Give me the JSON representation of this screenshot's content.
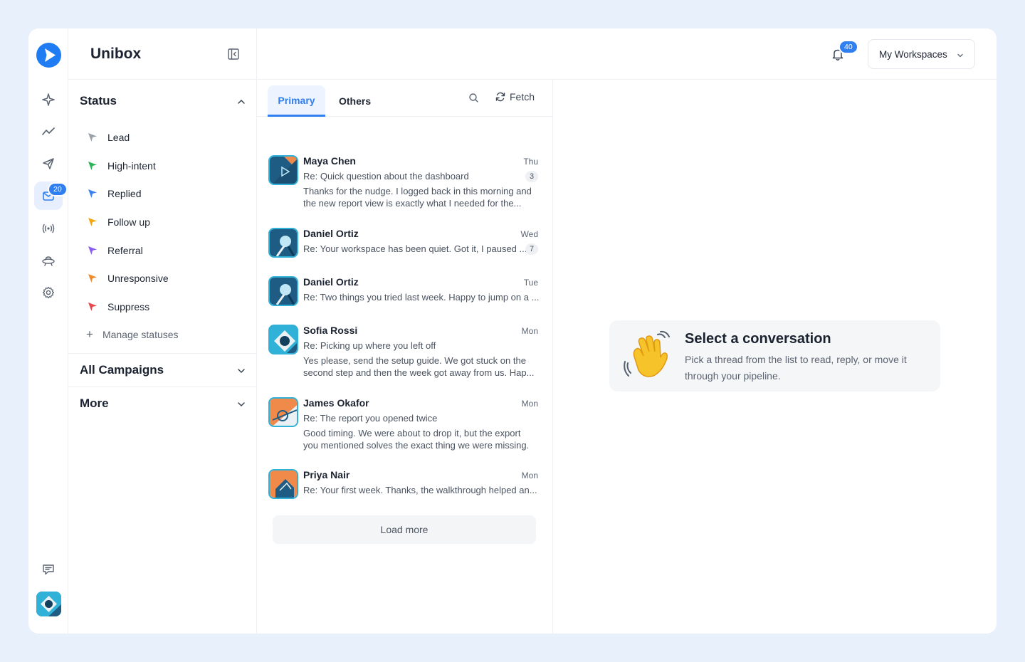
{
  "app": {
    "title": "Unibox"
  },
  "rail": {
    "inbox_badge": "20",
    "items": [
      "sparkle-icon",
      "analytics-icon",
      "send-icon",
      "inbox-icon",
      "broadcast-icon",
      "ufo-icon",
      "gear-icon",
      "feedback-icon"
    ]
  },
  "topbar": {
    "notification_count": "40",
    "workspace": "My Workspaces"
  },
  "status": {
    "title": "Status",
    "items": [
      {
        "label": "Lead",
        "color": "#9aa0a8"
      },
      {
        "label": "High-intent",
        "color": "#2bb55a"
      },
      {
        "label": "Replied",
        "color": "#3b82f0"
      },
      {
        "label": "Follow up",
        "color": "#f2a712"
      },
      {
        "label": "Referral",
        "color": "#8a5cf0"
      },
      {
        "label": "Unresponsive",
        "color": "#f08a2e"
      },
      {
        "label": "Suppress",
        "color": "#e5484d"
      }
    ],
    "manage_label": "Manage statuses"
  },
  "sections": {
    "campaigns": "All Campaigns",
    "more": "More"
  },
  "tabs": {
    "primary": "Primary",
    "others": "Others",
    "fetch": "Fetch"
  },
  "threads": [
    {
      "name": "Maya Chen",
      "day": "Thu",
      "subject": "Re: Quick question about the dashboard",
      "count": "3",
      "body": "Thanks for the nudge. I logged back in this morning and the new report view is exactly what I needed for the..."
    },
    {
      "name": "Daniel Ortiz",
      "day": "Wed",
      "subject": "Re: Your workspace has been quiet. Got it, I paused ...",
      "count": "7",
      "body": ""
    },
    {
      "name": "Daniel Ortiz",
      "day": "Tue",
      "subject": "Re: Two things you tried last week. Happy to jump on a ...",
      "count": "",
      "body": ""
    },
    {
      "name": "Sofia Rossi",
      "day": "Mon",
      "subject": "Re: Picking up where you left off",
      "count": "",
      "body": "Yes please, send the setup guide. We got stuck on the second step and then the week got away from us. Hap..."
    },
    {
      "name": "James Okafor",
      "day": "Mon",
      "subject": "Re: The report you opened twice",
      "count": "",
      "body": "Good timing. We were about to drop it, but the export you mentioned solves the exact thing we were missing."
    },
    {
      "name": "Priya Nair",
      "day": "Mon",
      "subject": "Re: Your first week. Thanks, the walkthrough helped an...",
      "count": "",
      "body": ""
    }
  ],
  "load_more": "Load more",
  "empty_state": {
    "title": "Select a conversation",
    "text": "Pick a thread from the list to read, reply, or move it through your pipeline."
  }
}
